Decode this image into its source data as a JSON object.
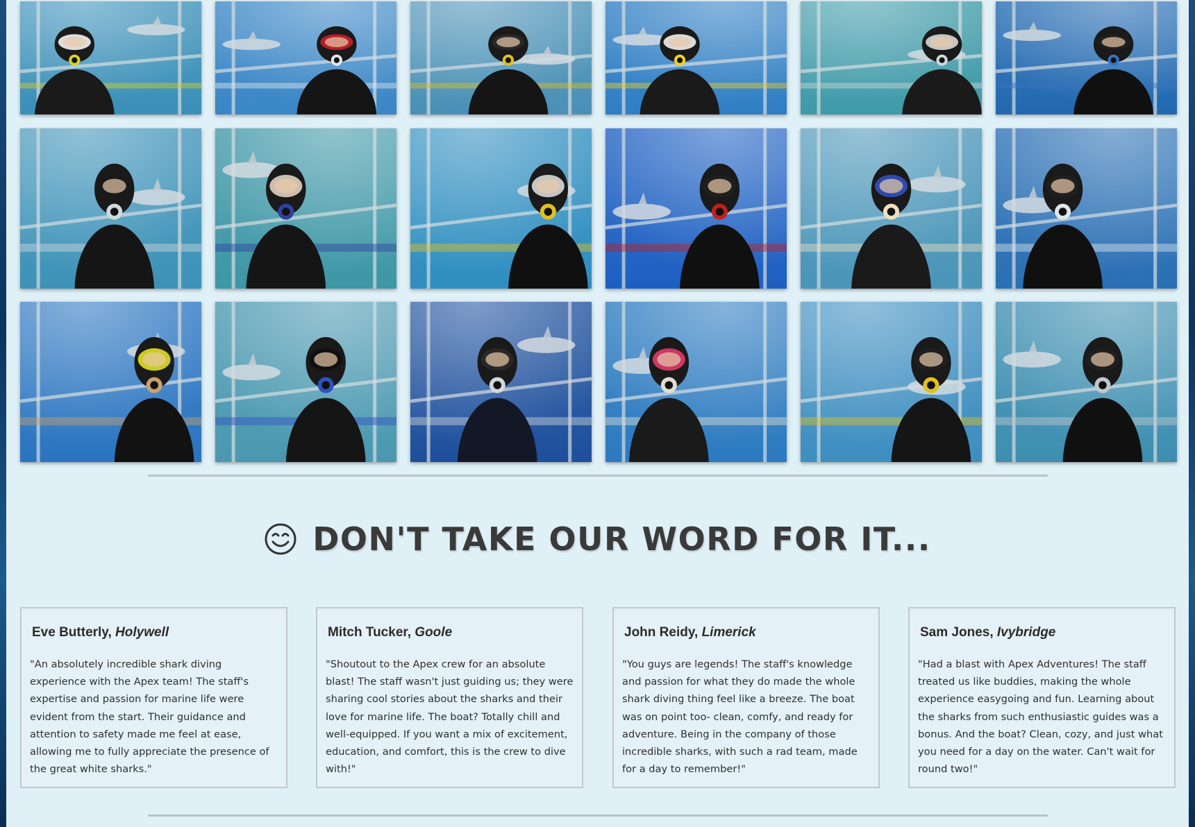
{
  "gallery": {
    "photos": [
      {
        "name": "diver-photo-1",
        "bg": "#3a8fb8",
        "gear": "#1a1a1a",
        "mask": "#f2f2f2",
        "accent": "#d8d02a"
      },
      {
        "name": "diver-photo-2",
        "bg": "#3a86c6",
        "gear": "#151515",
        "mask": "#c8202a",
        "accent": "#e0e6ea"
      },
      {
        "name": "diver-photo-3",
        "bg": "#4a90b6",
        "gear": "#151515",
        "mask": "#2a2a2a",
        "accent": "#e0c020"
      },
      {
        "name": "diver-photo-4",
        "bg": "#2f7ec4",
        "gear": "#1a1a1a",
        "mask": "#f0f0f0",
        "accent": "#f0d020"
      },
      {
        "name": "diver-photo-5",
        "bg": "#3f9aa8",
        "gear": "#1a1a1a",
        "mask": "#d8d8d8",
        "accent": "#cfd6d8"
      },
      {
        "name": "diver-photo-6",
        "bg": "#2168b0",
        "gear": "#101010",
        "mask": "#202020",
        "accent": "#3a72c0"
      },
      {
        "name": "diver-photo-7",
        "bg": "#3d92b8",
        "gear": "#151515",
        "mask": "#1a1a1a",
        "accent": "#d0d8dc"
      },
      {
        "name": "diver-photo-8",
        "bg": "#3e97a6",
        "gear": "#151515",
        "mask": "#e0d0c0",
        "accent": "#3040a0"
      },
      {
        "name": "diver-photo-9",
        "bg": "#2f8ec0",
        "gear": "#101010",
        "mask": "#d8d8d8",
        "accent": "#e0c020"
      },
      {
        "name": "diver-photo-10",
        "bg": "#1d5fc2",
        "gear": "#101010",
        "mask": "#202020",
        "accent": "#c02020"
      },
      {
        "name": "diver-photo-11",
        "bg": "#4a95b8",
        "gear": "#1a1a1a",
        "mask": "#3050c0",
        "accent": "#f0e0c0"
      },
      {
        "name": "diver-photo-12",
        "bg": "#2a6fb4",
        "gear": "#101010",
        "mask": "#202020",
        "accent": "#e0e6ea"
      },
      {
        "name": "diver-photo-13",
        "bg": "#2a74c0",
        "gear": "#121212",
        "mask": "#e0e020",
        "accent": "#c8a070"
      },
      {
        "name": "diver-photo-14",
        "bg": "#4a98b0",
        "gear": "#151515",
        "mask": "#101010",
        "accent": "#3050c0"
      },
      {
        "name": "diver-photo-15",
        "bg": "#1e4f9c",
        "gear": "#121826",
        "mask": "#2a2a2a",
        "accent": "#d0d8dc"
      },
      {
        "name": "diver-photo-16",
        "bg": "#2b7ac0",
        "gear": "#1a1a1a",
        "mask": "#e03a6a",
        "accent": "#e0e0d0"
      },
      {
        "name": "diver-photo-17",
        "bg": "#3e8ec0",
        "gear": "#151515",
        "mask": "#202020",
        "accent": "#e0c020"
      },
      {
        "name": "diver-photo-18",
        "bg": "#3d8eb0",
        "gear": "#101010",
        "mask": "#202020",
        "accent": "#c0c8cc"
      }
    ]
  },
  "testimonials": {
    "heading": "DON'T TAKE OUR WORD FOR IT...",
    "reviews": [
      {
        "author": "Eve Butterly,",
        "location": "Holywell",
        "quote": "\"An absolutely incredible shark diving experience with the Apex team! The staff's expertise and passion for marine life were evident from the start. Their guidance and attention to safety made me feel at ease, allowing me to fully appreciate the presence of the great white sharks.\""
      },
      {
        "author": "Mitch Tucker,",
        "location": "Goole",
        "quote": "\"Shoutout to the Apex crew for an absolute blast! The staff wasn't just guiding us; they were sharing cool stories about the sharks and their love for marine life. The boat? Totally chill and well-equipped. If you want a mix of excitement, education, and comfort, this is the crew to dive with!\""
      },
      {
        "author": "John Reidy,",
        "location": "Limerick",
        "quote": "\"You guys are legends! The staff's knowledge and passion for what they do made the whole shark diving thing feel like a breeze. The boat was on point too- clean, comfy, and ready for adventure. Being in the company of those incredible sharks, with such a rad team, made for a day to remember!\""
      },
      {
        "author": "Sam Jones,",
        "location": "Ivybridge",
        "quote": "\"Had a blast with Apex Adventures! The staff treated us like buddies, making the whole experience easygoing and fun. Learning about the sharks from such enthusiastic guides was a bonus. And the boat? Clean, cozy, and just what you need for a day on the water. Can't wait for round two!\""
      }
    ]
  }
}
